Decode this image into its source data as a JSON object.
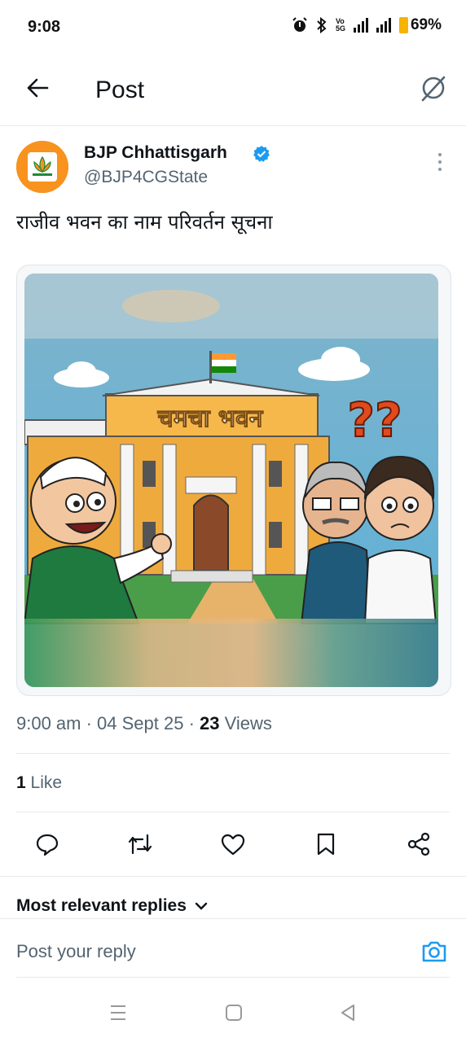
{
  "status_bar": {
    "time": "9:08",
    "battery": "69%",
    "network_vo": "Vo",
    "network_5g": "5G",
    "icons": [
      "alarm-icon",
      "bluetooth-icon",
      "volte-icon",
      "signal-icon",
      "signal-icon",
      "battery-icon"
    ]
  },
  "header": {
    "title": "Post",
    "back_icon": "back-arrow-icon",
    "grok_icon": "grok-icon"
  },
  "post": {
    "author_name": "BJP Chhattisgarh",
    "author_handle": "@BJP4CGState",
    "verified": true,
    "text": "राजीव भवन का नाम परिवर्तन सूचना",
    "image": {
      "building_sign": "चमचा भवन",
      "question_marks": "??"
    },
    "timestamp": "9:00 am · 04 Sept 25 · ",
    "views_count": "23",
    "views_label": " Views",
    "likes_count": "1",
    "likes_label": " Like"
  },
  "actions": [
    "reply-icon",
    "repost-icon",
    "like-icon",
    "bookmark-icon",
    "share-icon"
  ],
  "replies": {
    "sort_label": "Most relevant replies",
    "input_placeholder": "Post your reply"
  },
  "colors": {
    "accent": "#1d9bf0",
    "text": "#0f1419",
    "secondary": "#536471",
    "bjp_orange": "#f7931e"
  }
}
